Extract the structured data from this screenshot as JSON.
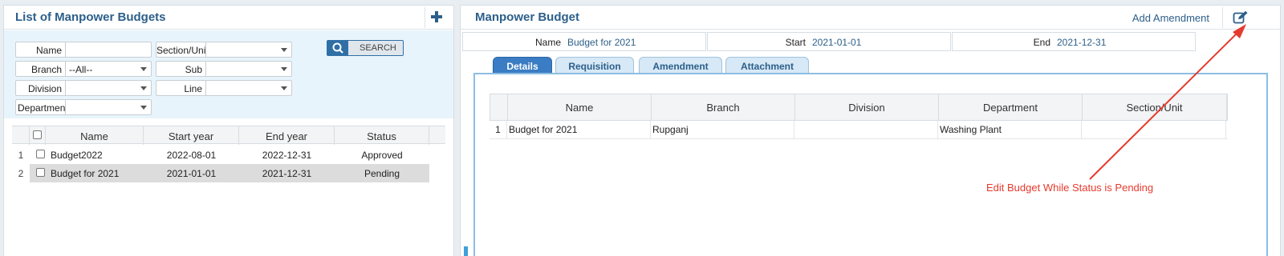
{
  "left": {
    "title": "List of Manpower Budgets",
    "add_icon": "plus-icon",
    "filters": {
      "name_label": "Name",
      "name_value": "",
      "section_label": "Section/Uni",
      "section_value": "",
      "branch_label": "Branch",
      "branch_value": "--All--",
      "sub_label": "Sub",
      "sub_value": "",
      "division_label": "Division",
      "division_value": "",
      "line_label": "Line",
      "line_value": "",
      "department_label": "Department",
      "department_value": "",
      "search_label": "SEARCH",
      "search_icon": "search-icon"
    },
    "table": {
      "columns": [
        "Name",
        "Start year",
        "End year",
        "Status"
      ],
      "rows": [
        {
          "num": "1",
          "name": "Budget2022",
          "start": "2022-08-01",
          "end": "2022-12-31",
          "status": "Approved"
        },
        {
          "num": "2",
          "name": "Budget for 2021",
          "start": "2021-01-01",
          "end": "2021-12-31",
          "status": "Pending"
        }
      ]
    }
  },
  "right": {
    "title": "Manpower Budget",
    "add_amendment": "Add Amendment",
    "edit_icon": "edit-icon",
    "info": {
      "name_label": "Name",
      "name_value": "Budget for 2021",
      "start_label": "Start",
      "start_value": "2021-01-01",
      "end_label": "End",
      "end_value": "2021-12-31"
    },
    "tabs": [
      "Details",
      "Requisition",
      "Amendment",
      "Attachment"
    ],
    "table": {
      "columns": [
        "Name",
        "Branch",
        "Division",
        "Department",
        "Section/Unit"
      ],
      "rows": [
        {
          "num": "1",
          "name": "Budget for 2021",
          "branch": "Rupganj",
          "division": "",
          "department": "Washing Plant",
          "section": ""
        }
      ]
    }
  },
  "annotation": {
    "text": "Edit Budget While Status is Pending",
    "color": "#e53a2e"
  },
  "colors": {
    "accent": "#2c5f8a",
    "filter_bg": "#e8f4fb",
    "active_tab": "#3a7dc4"
  }
}
